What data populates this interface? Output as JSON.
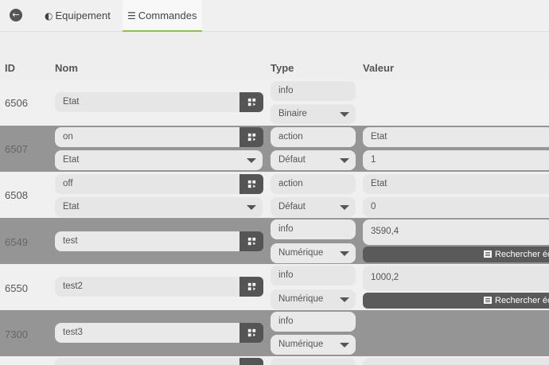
{
  "tabs": {
    "back_icon": "arrow-left-icon",
    "equipement": {
      "label": "Equipement",
      "icon": "gauge-icon"
    },
    "commandes": {
      "label": "Commandes",
      "icon": "list-icon"
    }
  },
  "columns": {
    "id": "ID",
    "nom": "Nom",
    "type": "Type",
    "valeur": "Valeur"
  },
  "rows": [
    {
      "id": "6506",
      "name": "Etat",
      "type": "info",
      "subtype": "Binaire"
    },
    {
      "id": "6507",
      "name": "on",
      "value_info": "Etat",
      "type": "action",
      "subtype": "Défaut",
      "value": "Etat",
      "value2": "1"
    },
    {
      "id": "6508",
      "name": "off",
      "value_info": "Etat",
      "type": "action",
      "subtype": "Défaut",
      "value": "Etat",
      "value2": "0"
    },
    {
      "id": "6549",
      "name": "test",
      "type": "info",
      "subtype": "Numérique",
      "value": "3590,4",
      "search_label": "Rechercher éq"
    },
    {
      "id": "6550",
      "name": "test2",
      "type": "info",
      "subtype": "Numérique",
      "value": "1000,2",
      "search_label": "Rechercher éq"
    },
    {
      "id": "7300",
      "name": "test3",
      "type": "info",
      "subtype": "Numérique"
    }
  ],
  "accent_color": "#8bc34a"
}
